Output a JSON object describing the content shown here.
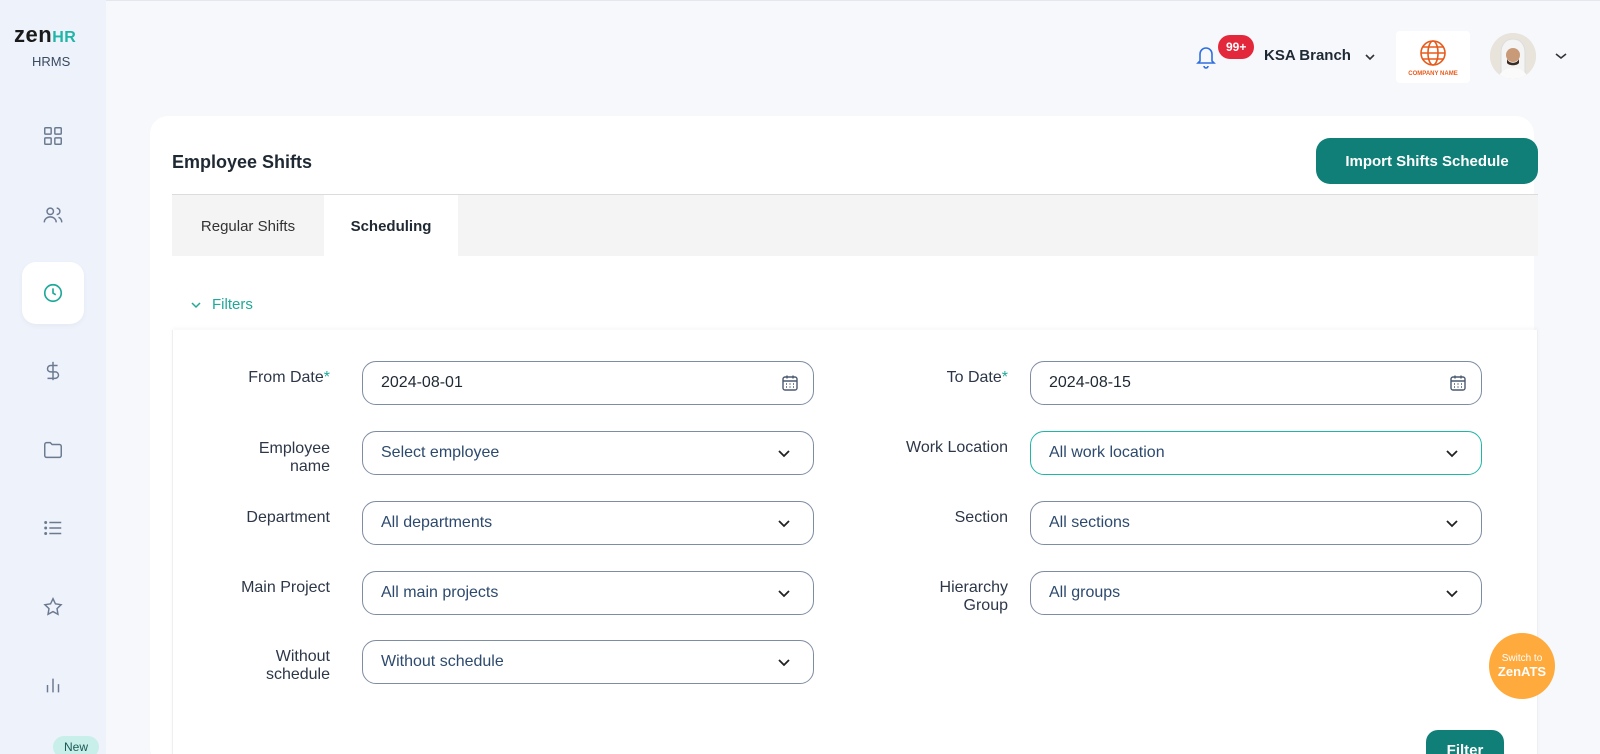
{
  "app": {
    "logo_main": "zen",
    "logo_accent": "HR",
    "logo_sub": "HRMS"
  },
  "sidebar": {
    "items": [
      {
        "name": "dashboard",
        "icon": "grid-icon"
      },
      {
        "name": "employees",
        "icon": "users-icon"
      },
      {
        "name": "time",
        "icon": "clock-icon",
        "active": true
      },
      {
        "name": "payroll",
        "icon": "dollar-icon"
      },
      {
        "name": "documents",
        "icon": "folder-icon"
      },
      {
        "name": "lists",
        "icon": "list-icon"
      },
      {
        "name": "performance",
        "icon": "star-icon"
      },
      {
        "name": "reports",
        "icon": "bar-chart-icon"
      }
    ],
    "new_badge": "New"
  },
  "topbar": {
    "notifications_count": "99+",
    "branch": "KSA Branch",
    "company_logo_text": "COMPANY NAME"
  },
  "page": {
    "title": "Employee Shifts",
    "import_button": "Import Shifts Schedule",
    "tabs": [
      {
        "label": "Regular Shifts",
        "active": false
      },
      {
        "label": "Scheduling",
        "active": true
      }
    ],
    "filters_label": "Filters",
    "filter_button": "Filter"
  },
  "filters": {
    "from_date": {
      "label": "From Date",
      "required": "*",
      "value": "2024-08-01"
    },
    "to_date": {
      "label": "To Date",
      "required": "*",
      "value": "2024-08-15"
    },
    "employee_name": {
      "label_line1": "Employee",
      "label_line2": "name",
      "value": "Select employee"
    },
    "work_location": {
      "label": "Work Location",
      "value": "All work location"
    },
    "department": {
      "label": "Department",
      "value": "All departments"
    },
    "section": {
      "label": "Section",
      "value": "All sections"
    },
    "main_project": {
      "label": "Main Project",
      "value": "All main projects"
    },
    "hierarchy_group": {
      "label_line1": "Hierarchy",
      "label_line2": "Group",
      "value": "All groups"
    },
    "without_schedule": {
      "label_line1": "Without",
      "label_line2": "schedule",
      "value": "Without schedule"
    }
  },
  "switch_ats": {
    "line1": "Switch to",
    "line2": "ZenATS"
  },
  "colors": {
    "accent": "#0f7f78",
    "teal": "#1fb5a7",
    "badge_red": "#e4283c",
    "ats_orange": "#ffaa3d",
    "sidebar_bg": "#eef2fb"
  }
}
